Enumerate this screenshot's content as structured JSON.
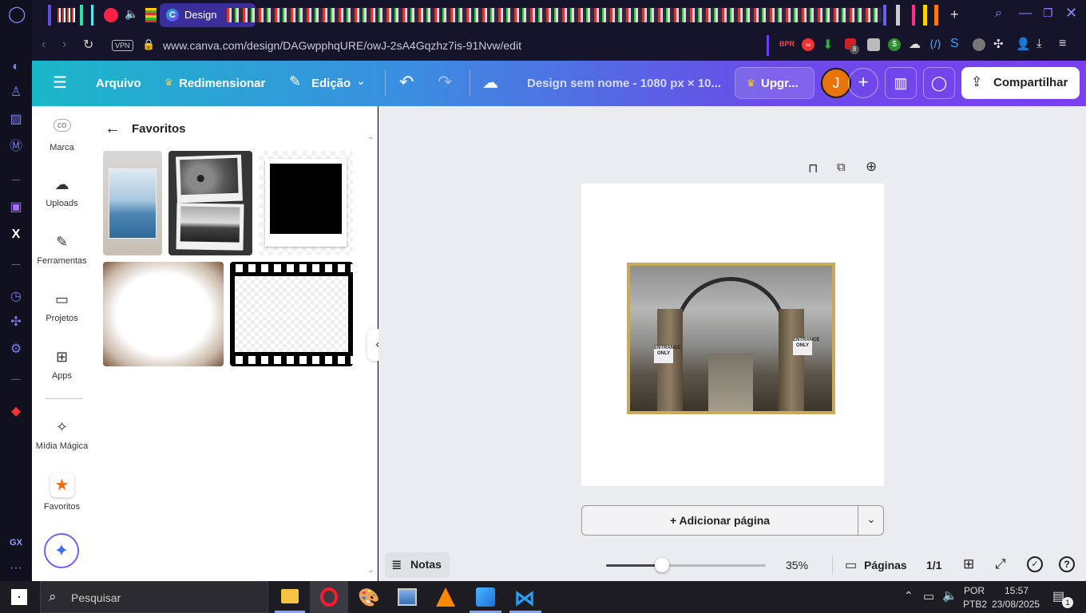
{
  "browser": {
    "tab_title": "Design",
    "vpn_label": "VPN",
    "url": "www.canva.com/design/DAGwpphqURE/owJ-2sA4Gqzhz7is-91Nvw/edit",
    "ext_badge": "8"
  },
  "header": {
    "file_label": "Arquivo",
    "resize_label": "Redimensionar",
    "edit_label": "Edição",
    "design_title": "Design sem nome - 1080 px × 10...",
    "upgrade_label": "Upgr...",
    "avatar_letter": "J",
    "share_label": "Compartilhar"
  },
  "rail": {
    "items": [
      {
        "label": "Marca"
      },
      {
        "label": "Uploads"
      },
      {
        "label": "Ferramentas"
      },
      {
        "label": "Projetos"
      },
      {
        "label": "Apps"
      },
      {
        "label": "Mídia Mágica"
      },
      {
        "label": "Favoritos"
      }
    ]
  },
  "panel": {
    "title": "Favoritos"
  },
  "canvas": {
    "add_page_label": "+ Adicionar página",
    "notes_label": "Notas",
    "zoom": "35%",
    "zoom_fraction": 0.35,
    "pages_label": "Páginas",
    "page_count": "1/1",
    "photo_sign_left": "ENTRANCE ONLY",
    "photo_sign_right": "ENTRANCE ONLY"
  },
  "taskbar": {
    "search_placeholder": "Pesquisar",
    "lang": "POR",
    "layout": "PTB2",
    "time": "15:57",
    "date": "23/08/2025",
    "notif_count": "1"
  },
  "colors": {
    "accent_orange": "#e8740c",
    "header_start": "#1bb7c9",
    "header_end": "#7b3ff0",
    "opera_red": "#ff1b2d"
  }
}
